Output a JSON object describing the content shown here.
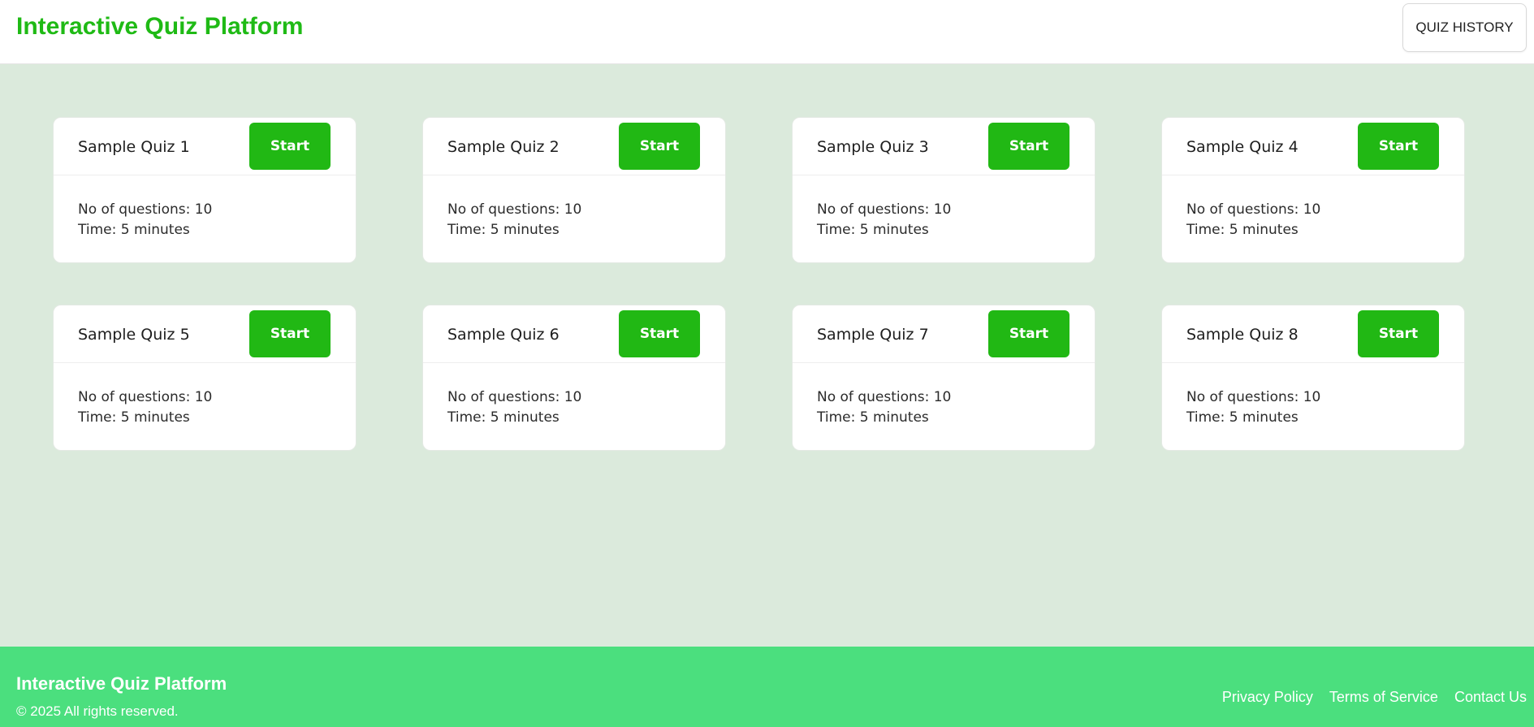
{
  "header": {
    "title": "Interactive Quiz Platform",
    "history_label": "QUIZ HISTORY"
  },
  "quizzes": [
    {
      "title": "Sample Quiz 1",
      "start_label": "Start",
      "questions": "No of questions: 10",
      "time": "Time: 5 minutes"
    },
    {
      "title": "Sample Quiz 2",
      "start_label": "Start",
      "questions": "No of questions: 10",
      "time": "Time: 5 minutes"
    },
    {
      "title": "Sample Quiz 3",
      "start_label": "Start",
      "questions": "No of questions: 10",
      "time": "Time: 5 minutes"
    },
    {
      "title": "Sample Quiz 4",
      "start_label": "Start",
      "questions": "No of questions: 10",
      "time": "Time: 5 minutes"
    },
    {
      "title": "Sample Quiz 5",
      "start_label": "Start",
      "questions": "No of questions: 10",
      "time": "Time: 5 minutes"
    },
    {
      "title": "Sample Quiz 6",
      "start_label": "Start",
      "questions": "No of questions: 10",
      "time": "Time: 5 minutes"
    },
    {
      "title": "Sample Quiz 7",
      "start_label": "Start",
      "questions": "No of questions: 10",
      "time": "Time: 5 minutes"
    },
    {
      "title": "Sample Quiz 8",
      "start_label": "Start",
      "questions": "No of questions: 10",
      "time": "Time: 5 minutes"
    }
  ],
  "footer": {
    "title": "Interactive Quiz Platform",
    "copyright": "© 2025 All rights reserved.",
    "links": [
      {
        "label": "Privacy Policy"
      },
      {
        "label": "Terms of Service"
      },
      {
        "label": "Contact Us"
      }
    ]
  },
  "colors": {
    "brand": "#1fba15",
    "start_button": "#21b814",
    "page_background": "#dbeadc",
    "footer_background": "#4bdf7e"
  }
}
